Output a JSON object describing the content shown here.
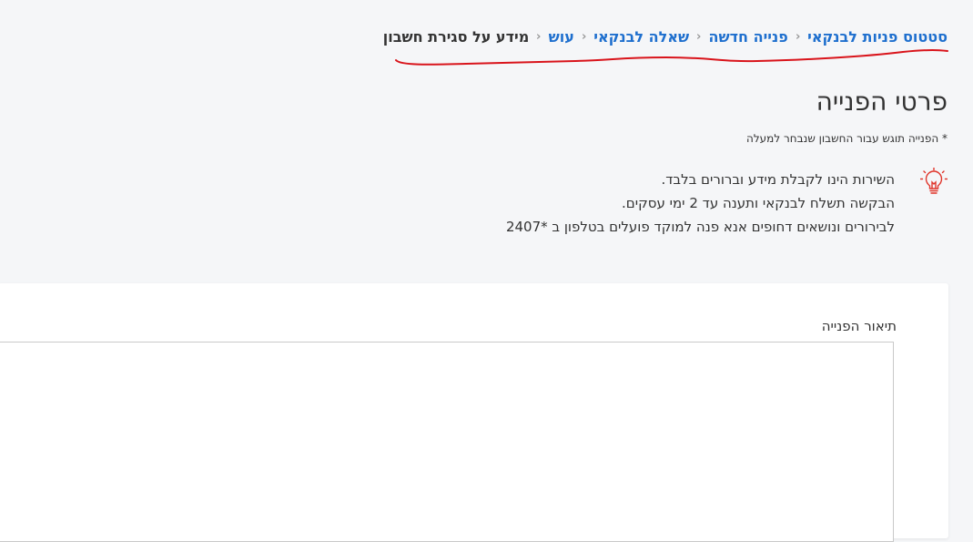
{
  "breadcrumb": {
    "items": [
      {
        "label": "סטטוס פניות לבנקאי"
      },
      {
        "label": "פנייה חדשה"
      },
      {
        "label": "שאלה לבנקאי"
      },
      {
        "label": "עוש"
      }
    ],
    "current": "מידע על סגירת חשבון",
    "separator": "›"
  },
  "page": {
    "title": "פרטי הפנייה",
    "note": "* הפנייה תוגש עבור החשבון שנבחר למעלה"
  },
  "info": {
    "icon": "lightbulb-icon",
    "lines": [
      "השירות הינו לקבלת מידע וברורים בלבד.",
      "הבקשה תשלח לבנקאי ותענה עד 2 ימי עסקים.",
      "לבירורים ונושאים דחופים אנא פנה למוקד פועלים בטלפון ב *2407"
    ]
  },
  "form": {
    "description_label": "תיאור הפנייה",
    "description_value": ""
  },
  "colors": {
    "link": "#1e6fce",
    "accent": "#e0352b",
    "annotation": "#d9141b",
    "background": "#f5f6f8"
  }
}
